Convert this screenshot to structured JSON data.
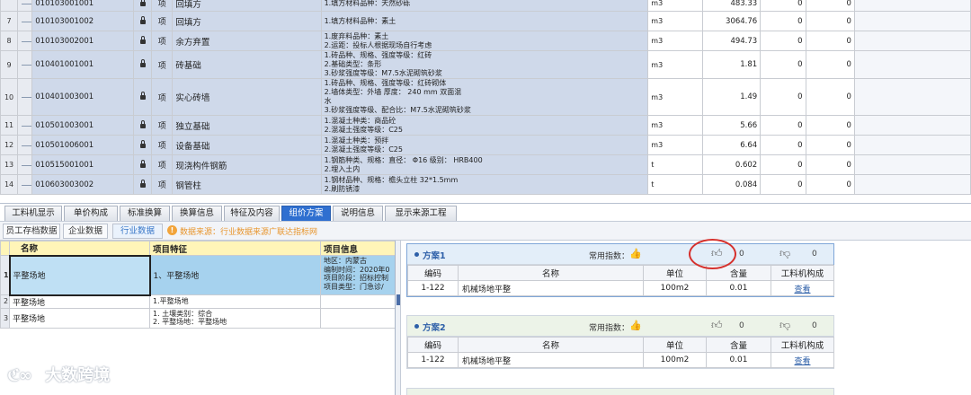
{
  "grid": {
    "rows": [
      {
        "num": "",
        "code": "010103001001",
        "type": "项",
        "name": "回填方",
        "features": [
          "1.填方材料品种：天然砂砾"
        ],
        "unit": "m3",
        "qty": "483.33",
        "z1": "0",
        "z2": "0"
      },
      {
        "num": "7",
        "code": "010103001002",
        "type": "项",
        "name": "回填方",
        "features": [
          "1.填方材料品种：素土"
        ],
        "unit": "m3",
        "qty": "3064.76",
        "z1": "0",
        "z2": "0"
      },
      {
        "num": "8",
        "code": "010103002001",
        "type": "项",
        "name": "余方弃置",
        "features": [
          "1.废弃料品种：素土",
          "2.运距：投标人根据现场自行考虑"
        ],
        "unit": "m3",
        "qty": "494.73",
        "z1": "0",
        "z2": "0"
      },
      {
        "num": "9",
        "code": "010401001001",
        "type": "项",
        "name": "砖基础",
        "features": [
          "1.砖品种、规格、强度等级：红砖",
          "2.基础类型：条形",
          "3.砂浆强度等级：M7.5水泥砌筑砂浆"
        ],
        "unit": "m3",
        "qty": "1.81",
        "z1": "0",
        "z2": "0"
      },
      {
        "num": "10",
        "code": "010401003001",
        "type": "项",
        "name": "实心砖墙",
        "features": [
          "1.砖品种、规格、强度等级：红砖砌体",
          "2.墙体类型：外墙    厚度： 240  mm    双面混",
          "水",
          "3.砂浆强度等级、配合比：M7.5水泥砌筑砂浆"
        ],
        "unit": "m3",
        "qty": "1.49",
        "z1": "0",
        "z2": "0"
      },
      {
        "num": "11",
        "code": "010501003001",
        "type": "项",
        "name": "独立基础",
        "features": [
          "1.混凝土种类：商品砼",
          "2.混凝土强度等级：C25"
        ],
        "unit": "m3",
        "qty": "5.66",
        "z1": "0",
        "z2": "0"
      },
      {
        "num": "12",
        "code": "010501006001",
        "type": "项",
        "name": "设备基础",
        "features": [
          "1.混凝土种类：预拌",
          "2.混凝土强度等级：C25"
        ],
        "unit": "m3",
        "qty": "6.64",
        "z1": "0",
        "z2": "0"
      },
      {
        "num": "13",
        "code": "010515001001",
        "type": "项",
        "name": "现浇构件钢筋",
        "features": [
          "1.钢筋种类、规格：直径： Φ16    级别： HRB400",
          "2.埋入土内"
        ],
        "unit": "t",
        "qty": "0.602",
        "z1": "0",
        "z2": "0"
      },
      {
        "num": "14",
        "code": "010603003002",
        "type": "项",
        "name": "钢管柱",
        "features": [
          "1.钢材品种、规格：檐头立柱   32*1.5mm",
          "2.刷防锈漆"
        ],
        "unit": "t",
        "qty": "0.084",
        "z1": "0",
        "z2": "0"
      }
    ]
  },
  "tabs": [
    "工料机显示",
    "单价构成",
    "标准换算",
    "换算信息",
    "特征及内容",
    "组价方案",
    "说明信息",
    "显示来源工程"
  ],
  "active_tab": "组价方案",
  "subtabs": [
    "员工存档数据",
    "企业数据",
    "行业数据"
  ],
  "active_subtab": "行业数据",
  "source_text": "数据来源：行业数据来源广联达指标网",
  "left": {
    "headers": [
      "名称",
      "项目特征",
      "项目信息"
    ],
    "rows": [
      {
        "num": "1",
        "name": "平整场地",
        "feature": [
          "1、平整场地"
        ],
        "info": [
          "地区：内蒙古",
          "编制时间：2020年0",
          "项目阶段：招标控制",
          "项目类型：门急诊/"
        ]
      },
      {
        "num": "2",
        "name": "平整场地",
        "feature": [
          "1.平整场地"
        ],
        "info": []
      },
      {
        "num": "3",
        "name": "平整场地",
        "feature": [
          "1. 土壤类别：综合",
          "2. 平整场地：平整场地"
        ],
        "info": []
      }
    ]
  },
  "plans": [
    {
      "title": "方案1",
      "freq_label": "常用指数：",
      "up_count": "0",
      "down_count": "0",
      "headers": [
        "编码",
        "名称",
        "单位",
        "含量",
        "工料机构成"
      ],
      "row": {
        "code": "1-122",
        "name": "机械场地平整",
        "unit": "100m2",
        "qty": "0.01",
        "action": "查看"
      }
    },
    {
      "title": "方案2",
      "freq_label": "常用指数：",
      "up_count": "0",
      "down_count": "0",
      "headers": [
        "编码",
        "名称",
        "单位",
        "含量",
        "工料机构成"
      ],
      "row": {
        "code": "1-122",
        "name": "机械场地平整",
        "unit": "100m2",
        "qty": "0.01",
        "action": "查看"
      }
    }
  ],
  "watermark": "大数跨境",
  "colors": {
    "accent": "#2f6fd0",
    "highlight_ring": "#d6302c",
    "selected_row": "#a6d2ee",
    "header_yellow": "#fff5b8"
  }
}
